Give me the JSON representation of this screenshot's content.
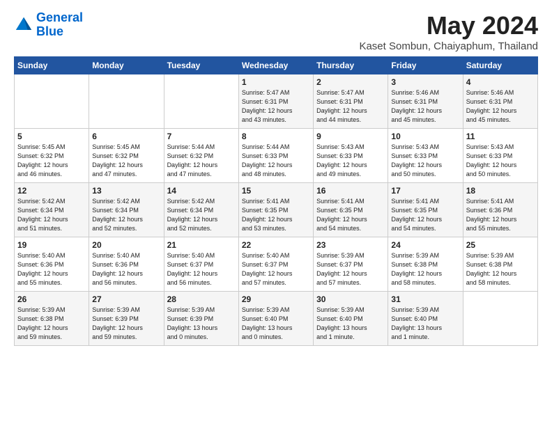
{
  "header": {
    "logo_line1": "General",
    "logo_line2": "Blue",
    "month_year": "May 2024",
    "location": "Kaset Sombun, Chaiyaphum, Thailand"
  },
  "weekdays": [
    "Sunday",
    "Monday",
    "Tuesday",
    "Wednesday",
    "Thursday",
    "Friday",
    "Saturday"
  ],
  "weeks": [
    [
      {
        "day": "",
        "info": ""
      },
      {
        "day": "",
        "info": ""
      },
      {
        "day": "",
        "info": ""
      },
      {
        "day": "1",
        "info": "Sunrise: 5:47 AM\nSunset: 6:31 PM\nDaylight: 12 hours\nand 43 minutes."
      },
      {
        "day": "2",
        "info": "Sunrise: 5:47 AM\nSunset: 6:31 PM\nDaylight: 12 hours\nand 44 minutes."
      },
      {
        "day": "3",
        "info": "Sunrise: 5:46 AM\nSunset: 6:31 PM\nDaylight: 12 hours\nand 45 minutes."
      },
      {
        "day": "4",
        "info": "Sunrise: 5:46 AM\nSunset: 6:31 PM\nDaylight: 12 hours\nand 45 minutes."
      }
    ],
    [
      {
        "day": "5",
        "info": "Sunrise: 5:45 AM\nSunset: 6:32 PM\nDaylight: 12 hours\nand 46 minutes."
      },
      {
        "day": "6",
        "info": "Sunrise: 5:45 AM\nSunset: 6:32 PM\nDaylight: 12 hours\nand 47 minutes."
      },
      {
        "day": "7",
        "info": "Sunrise: 5:44 AM\nSunset: 6:32 PM\nDaylight: 12 hours\nand 47 minutes."
      },
      {
        "day": "8",
        "info": "Sunrise: 5:44 AM\nSunset: 6:33 PM\nDaylight: 12 hours\nand 48 minutes."
      },
      {
        "day": "9",
        "info": "Sunrise: 5:43 AM\nSunset: 6:33 PM\nDaylight: 12 hours\nand 49 minutes."
      },
      {
        "day": "10",
        "info": "Sunrise: 5:43 AM\nSunset: 6:33 PM\nDaylight: 12 hours\nand 50 minutes."
      },
      {
        "day": "11",
        "info": "Sunrise: 5:43 AM\nSunset: 6:33 PM\nDaylight: 12 hours\nand 50 minutes."
      }
    ],
    [
      {
        "day": "12",
        "info": "Sunrise: 5:42 AM\nSunset: 6:34 PM\nDaylight: 12 hours\nand 51 minutes."
      },
      {
        "day": "13",
        "info": "Sunrise: 5:42 AM\nSunset: 6:34 PM\nDaylight: 12 hours\nand 52 minutes."
      },
      {
        "day": "14",
        "info": "Sunrise: 5:42 AM\nSunset: 6:34 PM\nDaylight: 12 hours\nand 52 minutes."
      },
      {
        "day": "15",
        "info": "Sunrise: 5:41 AM\nSunset: 6:35 PM\nDaylight: 12 hours\nand 53 minutes."
      },
      {
        "day": "16",
        "info": "Sunrise: 5:41 AM\nSunset: 6:35 PM\nDaylight: 12 hours\nand 54 minutes."
      },
      {
        "day": "17",
        "info": "Sunrise: 5:41 AM\nSunset: 6:35 PM\nDaylight: 12 hours\nand 54 minutes."
      },
      {
        "day": "18",
        "info": "Sunrise: 5:41 AM\nSunset: 6:36 PM\nDaylight: 12 hours\nand 55 minutes."
      }
    ],
    [
      {
        "day": "19",
        "info": "Sunrise: 5:40 AM\nSunset: 6:36 PM\nDaylight: 12 hours\nand 55 minutes."
      },
      {
        "day": "20",
        "info": "Sunrise: 5:40 AM\nSunset: 6:36 PM\nDaylight: 12 hours\nand 56 minutes."
      },
      {
        "day": "21",
        "info": "Sunrise: 5:40 AM\nSunset: 6:37 PM\nDaylight: 12 hours\nand 56 minutes."
      },
      {
        "day": "22",
        "info": "Sunrise: 5:40 AM\nSunset: 6:37 PM\nDaylight: 12 hours\nand 57 minutes."
      },
      {
        "day": "23",
        "info": "Sunrise: 5:39 AM\nSunset: 6:37 PM\nDaylight: 12 hours\nand 57 minutes."
      },
      {
        "day": "24",
        "info": "Sunrise: 5:39 AM\nSunset: 6:38 PM\nDaylight: 12 hours\nand 58 minutes."
      },
      {
        "day": "25",
        "info": "Sunrise: 5:39 AM\nSunset: 6:38 PM\nDaylight: 12 hours\nand 58 minutes."
      }
    ],
    [
      {
        "day": "26",
        "info": "Sunrise: 5:39 AM\nSunset: 6:38 PM\nDaylight: 12 hours\nand 59 minutes."
      },
      {
        "day": "27",
        "info": "Sunrise: 5:39 AM\nSunset: 6:39 PM\nDaylight: 12 hours\nand 59 minutes."
      },
      {
        "day": "28",
        "info": "Sunrise: 5:39 AM\nSunset: 6:39 PM\nDaylight: 13 hours\nand 0 minutes."
      },
      {
        "day": "29",
        "info": "Sunrise: 5:39 AM\nSunset: 6:40 PM\nDaylight: 13 hours\nand 0 minutes."
      },
      {
        "day": "30",
        "info": "Sunrise: 5:39 AM\nSunset: 6:40 PM\nDaylight: 13 hours\nand 1 minute."
      },
      {
        "day": "31",
        "info": "Sunrise: 5:39 AM\nSunset: 6:40 PM\nDaylight: 13 hours\nand 1 minute."
      },
      {
        "day": "",
        "info": ""
      }
    ]
  ]
}
